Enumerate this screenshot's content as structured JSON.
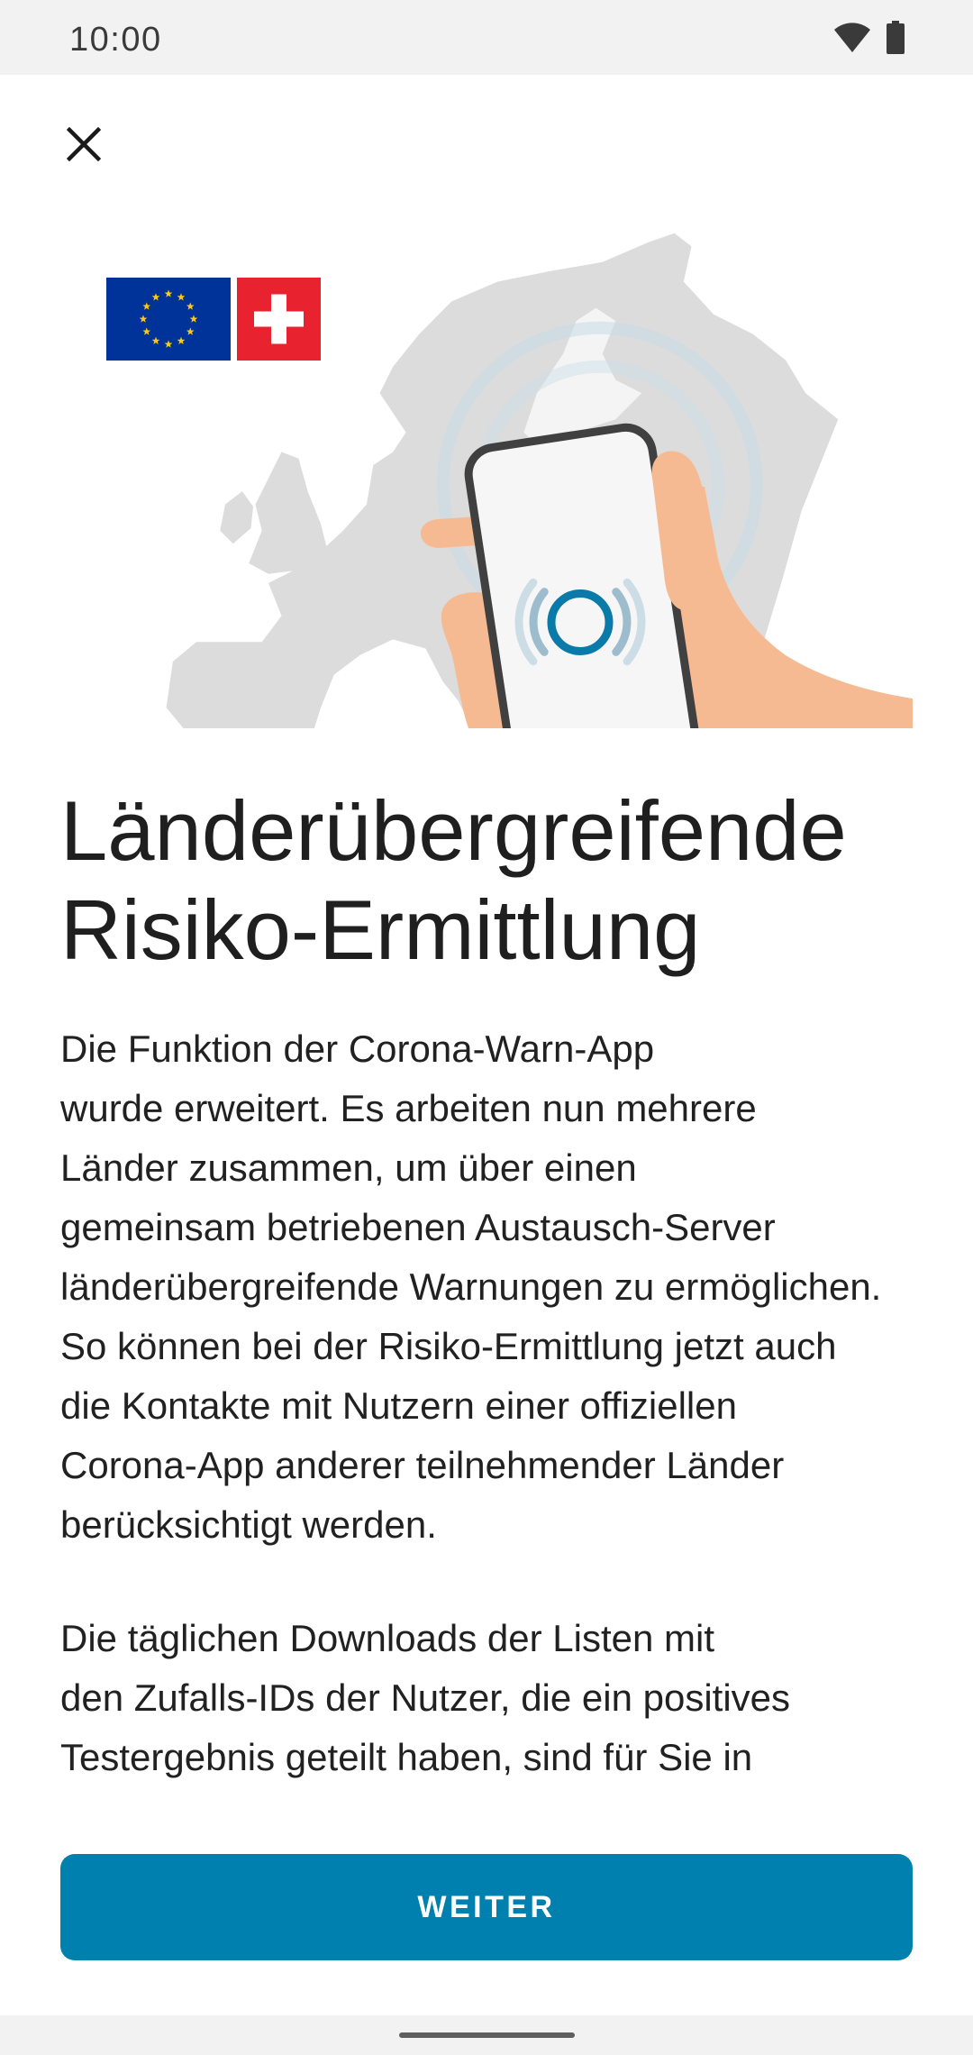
{
  "status_bar": {
    "time": "10:00",
    "wifi_icon": "wifi-icon",
    "battery_icon": "battery-icon"
  },
  "header": {
    "close_icon": "close-icon"
  },
  "illustration": {
    "flags": [
      "eu-flag",
      "swiss-flag"
    ],
    "device": "phone-icon",
    "signal": "signal-ring-icon"
  },
  "title": "Länderübergreifende Risiko-Ermittlung",
  "body": {
    "paragraph_1": [
      "Die Funktion der Corona-Warn-App",
      "wurde erweitert. Es arbeiten nun mehrere",
      "Länder zusammen, um über einen",
      "gemeinsam betriebenen Austausch-Server",
      "länderübergreifende Warnungen zu ermöglichen.",
      "So können bei der Risiko-Ermittlung jetzt auch",
      "die Kontakte mit Nutzern einer offiziellen",
      "Corona-App anderer teilnehmender Länder",
      "berücksichtigt werden."
    ],
    "paragraph_2": [
      "Die täglichen Downloads der Listen mit",
      "den Zufalls-IDs der Nutzer, die ein positives",
      "Testergebnis geteilt haben, sind für Sie in"
    ]
  },
  "footer": {
    "button_label": "WEITER"
  },
  "colors": {
    "accent": "#0080AE",
    "text": "#1F1F1F",
    "system_bars": "#F2F2F2",
    "map": "#DCDCDC",
    "skin": "#F6BA93",
    "eu_blue": "#003399",
    "eu_yellow": "#FFCC00",
    "swiss_red": "#E8232F"
  }
}
